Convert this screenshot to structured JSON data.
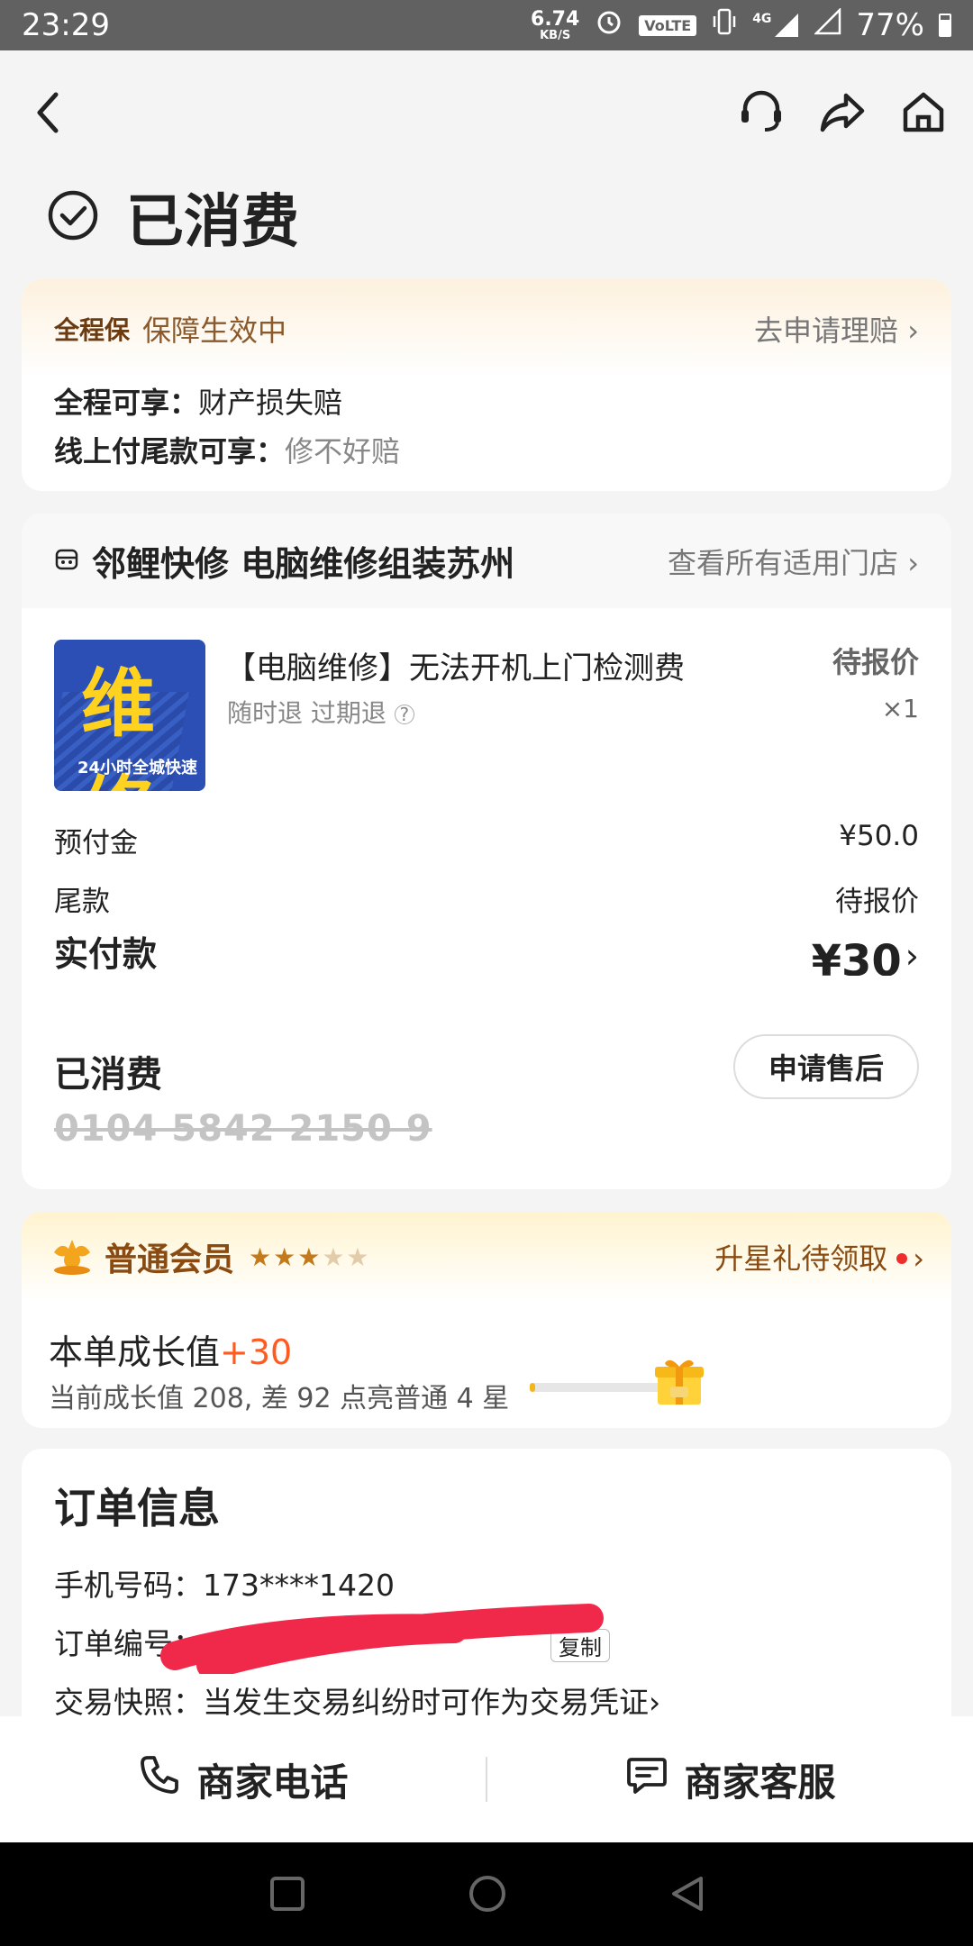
{
  "status_bar": {
    "time": "23:29",
    "net_speed": "6.74",
    "net_unit": "KB/S",
    "volte": "VoLTE",
    "network": "4G",
    "battery": "77%"
  },
  "header": {
    "title": "已消费"
  },
  "protection": {
    "brand": "全程保",
    "status": "保障生效中",
    "claim_link": "去申请理赔",
    "line1_key": "全程可享：",
    "line1_value": "财产损失赔",
    "line2_key": "线上付尾款可享：",
    "line2_value": "修不好赔"
  },
  "store": {
    "name": "邻鲤快修 电脑维修组装苏州",
    "all_stores_link": "查看所有适用门店",
    "product": {
      "title": "【电脑维修】无法开机上门检测费",
      "tags": "随时退 过期退",
      "price": "待报价",
      "qty": "×1",
      "thumb_text": "维修",
      "thumb_caption": "24小时全城快速"
    },
    "fees": [
      {
        "label": "预付金",
        "value": "¥50.0"
      },
      {
        "label": "尾款",
        "value": "待报价"
      }
    ],
    "paid_label": "实付款",
    "paid_value": "¥30",
    "consumed_label": "已消费",
    "after_sale_button": "申请售后",
    "voucher_code": "0104 5842 2150 9"
  },
  "member": {
    "level": "普通会员",
    "stars_on": "★★★",
    "stars_off": "★★",
    "star_count": 3,
    "star_total": 5,
    "gift_link": "升星礼待领取",
    "growth_label": "本单成长值",
    "growth_plus": "+30",
    "growth_note": "当前成长值 208, 差 92 点亮普通 4 星",
    "growth_progress": 0.04
  },
  "order_info": {
    "title": "订单信息",
    "phone_label": "手机号码：",
    "phone_value": "173****1420",
    "order_no_label": "订单编号：",
    "copy_button": "复制",
    "snapshot_label": "交易快照：",
    "snapshot_value": "当发生交易纠纷时可作为交易凭证"
  },
  "bottom_bar": {
    "phone_button": "商家电话",
    "chat_button": "商家客服"
  },
  "colors": {
    "accent": "#ff5a1f",
    "brand_brown": "#8a4b12",
    "redact": "#f0294b"
  }
}
